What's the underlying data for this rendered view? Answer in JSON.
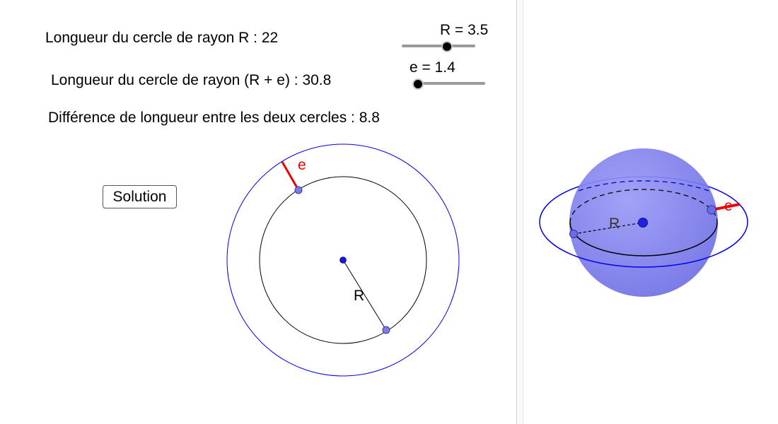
{
  "text_lines": {
    "circumference_R": "Longueur du cercle de rayon R : 22",
    "circumference_R_plus_e": "Longueur du cercle de rayon (R + e) : 30.8",
    "difference": "Différence de longueur entre les deux cercles : 8.8"
  },
  "sliders": {
    "R": {
      "label": "R = 3.5",
      "value": 3.5
    },
    "e": {
      "label": "e = 1.4",
      "value": 1.4
    }
  },
  "solution_button": {
    "label": "Solution"
  },
  "view2d": {
    "e_label": "e",
    "R_label": "R",
    "colors": {
      "outer_circle": "#0000ee",
      "inner_circle": "#000000",
      "e_segment": "#ee0000",
      "point_fill": "#7b7bea",
      "center": "#1414e6"
    }
  },
  "view3d": {
    "e_label": "e",
    "R_label": "R",
    "colors": {
      "sphere": "#7f7ff2",
      "equator_outer": "#0000ee",
      "e_segment": "#ee0000"
    }
  }
}
